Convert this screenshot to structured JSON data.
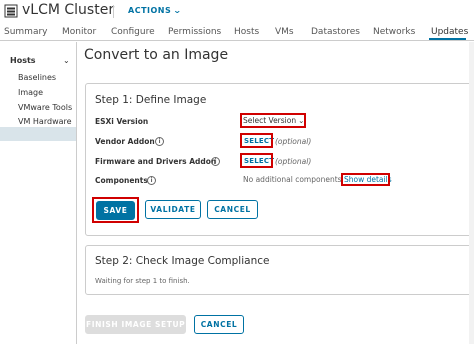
{
  "header": {
    "title": "vLCM Cluster",
    "actions_label": "ACTIONS",
    "cluster_icon": "cluster-icon"
  },
  "tabs": [
    {
      "label": "Summary"
    },
    {
      "label": "Monitor"
    },
    {
      "label": "Configure"
    },
    {
      "label": "Permissions"
    },
    {
      "label": "Hosts"
    },
    {
      "label": "VMs"
    },
    {
      "label": "Datastores"
    },
    {
      "label": "Networks"
    },
    {
      "label": "Updates",
      "active": true
    }
  ],
  "sidebar": {
    "group": "Hosts",
    "items": [
      {
        "label": "Baselines"
      },
      {
        "label": "Image",
        "selected": true
      },
      {
        "label": "VMware Tools"
      },
      {
        "label": "VM Hardware"
      }
    ]
  },
  "main": {
    "title": "Convert to an Image",
    "step1": {
      "title": "Step 1: Define Image",
      "esxi_label": "ESXi Version",
      "esxi_value": "Select Version",
      "vendor_label": "Vendor Addon",
      "vendor_link": "SELECT",
      "vendor_optional": "(optional)",
      "firmware_label": "Firmware and Drivers Addon",
      "firmware_link": "SELECT",
      "firmware_optional": "(optional)",
      "components_label": "Components",
      "components_value": "No additional components",
      "show_details": "Show details",
      "save_label": "SAVE",
      "validate_label": "VALIDATE",
      "cancel_label": "CANCEL"
    },
    "step2": {
      "title": "Step 2: Check Image Compliance",
      "waiting": "Waiting for step 1 to finish."
    },
    "finish_label": "FINISH IMAGE SETUP",
    "cancel_label": "CANCEL"
  },
  "colors": {
    "accent": "#0072a3",
    "highlight": "#d00000",
    "selected_nav": "#d9e4ea"
  }
}
